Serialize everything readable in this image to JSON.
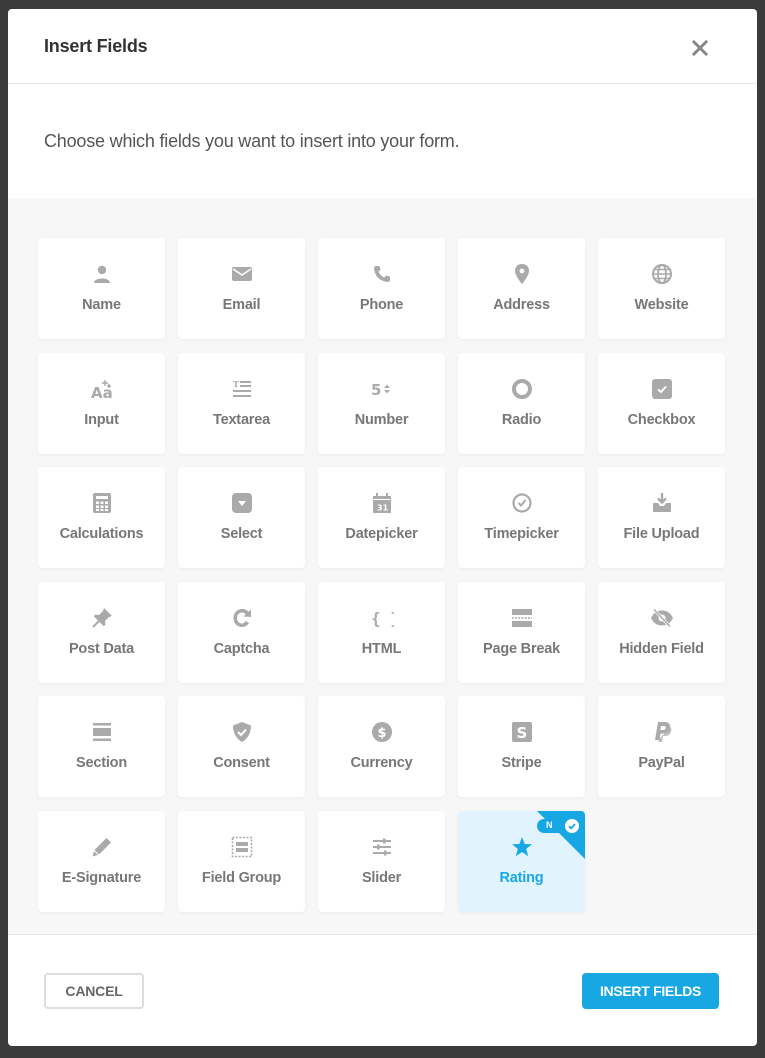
{
  "dialog": {
    "title": "Insert Fields",
    "close_label": "Close",
    "intro": "Choose which fields you want to insert into your form."
  },
  "fields": [
    {
      "label": "Name",
      "icon": "user-icon",
      "selected": false
    },
    {
      "label": "Email",
      "icon": "envelope-icon",
      "selected": false
    },
    {
      "label": "Phone",
      "icon": "phone-icon",
      "selected": false
    },
    {
      "label": "Address",
      "icon": "map-pin-icon",
      "selected": false
    },
    {
      "label": "Website",
      "icon": "globe-icon",
      "selected": false
    },
    {
      "label": "Input",
      "icon": "text-input-icon",
      "selected": false
    },
    {
      "label": "Textarea",
      "icon": "textarea-icon",
      "selected": false
    },
    {
      "label": "Number",
      "icon": "number-icon",
      "selected": false
    },
    {
      "label": "Radio",
      "icon": "radio-icon",
      "selected": false
    },
    {
      "label": "Checkbox",
      "icon": "checkbox-icon",
      "selected": false
    },
    {
      "label": "Calculations",
      "icon": "calculator-icon",
      "selected": false
    },
    {
      "label": "Select",
      "icon": "select-icon",
      "selected": false
    },
    {
      "label": "Datepicker",
      "icon": "calendar-icon",
      "selected": false
    },
    {
      "label": "Timepicker",
      "icon": "clock-icon",
      "selected": false
    },
    {
      "label": "File Upload",
      "icon": "upload-icon",
      "selected": false
    },
    {
      "label": "Post Data",
      "icon": "pin-icon",
      "selected": false
    },
    {
      "label": "Captcha",
      "icon": "captcha-icon",
      "selected": false
    },
    {
      "label": "HTML",
      "icon": "code-braces-icon",
      "selected": false
    },
    {
      "label": "Page Break",
      "icon": "page-break-icon",
      "selected": false
    },
    {
      "label": "Hidden Field",
      "icon": "eye-off-icon",
      "selected": false
    },
    {
      "label": "Section",
      "icon": "section-icon",
      "selected": false
    },
    {
      "label": "Consent",
      "icon": "shield-check-icon",
      "selected": false
    },
    {
      "label": "Currency",
      "icon": "dollar-icon",
      "selected": false
    },
    {
      "label": "Stripe",
      "icon": "stripe-icon",
      "selected": false
    },
    {
      "label": "PayPal",
      "icon": "paypal-icon",
      "selected": false
    },
    {
      "label": "E-Signature",
      "icon": "pencil-icon",
      "selected": false
    },
    {
      "label": "Field Group",
      "icon": "field-group-icon",
      "selected": false
    },
    {
      "label": "Slider",
      "icon": "sliders-icon",
      "selected": false
    },
    {
      "label": "Rating",
      "icon": "star-icon",
      "selected": true,
      "badge": "N"
    }
  ],
  "footer": {
    "cancel_label": "CANCEL",
    "insert_label": "INSERT FIELDS"
  },
  "colors": {
    "accent": "#17a8e3",
    "selected_bg": "#e1f4fd",
    "icon": "#aaaaaa",
    "label": "#777777",
    "overlay": "#3b3b3b",
    "grid_bg": "#f7f7f7"
  }
}
